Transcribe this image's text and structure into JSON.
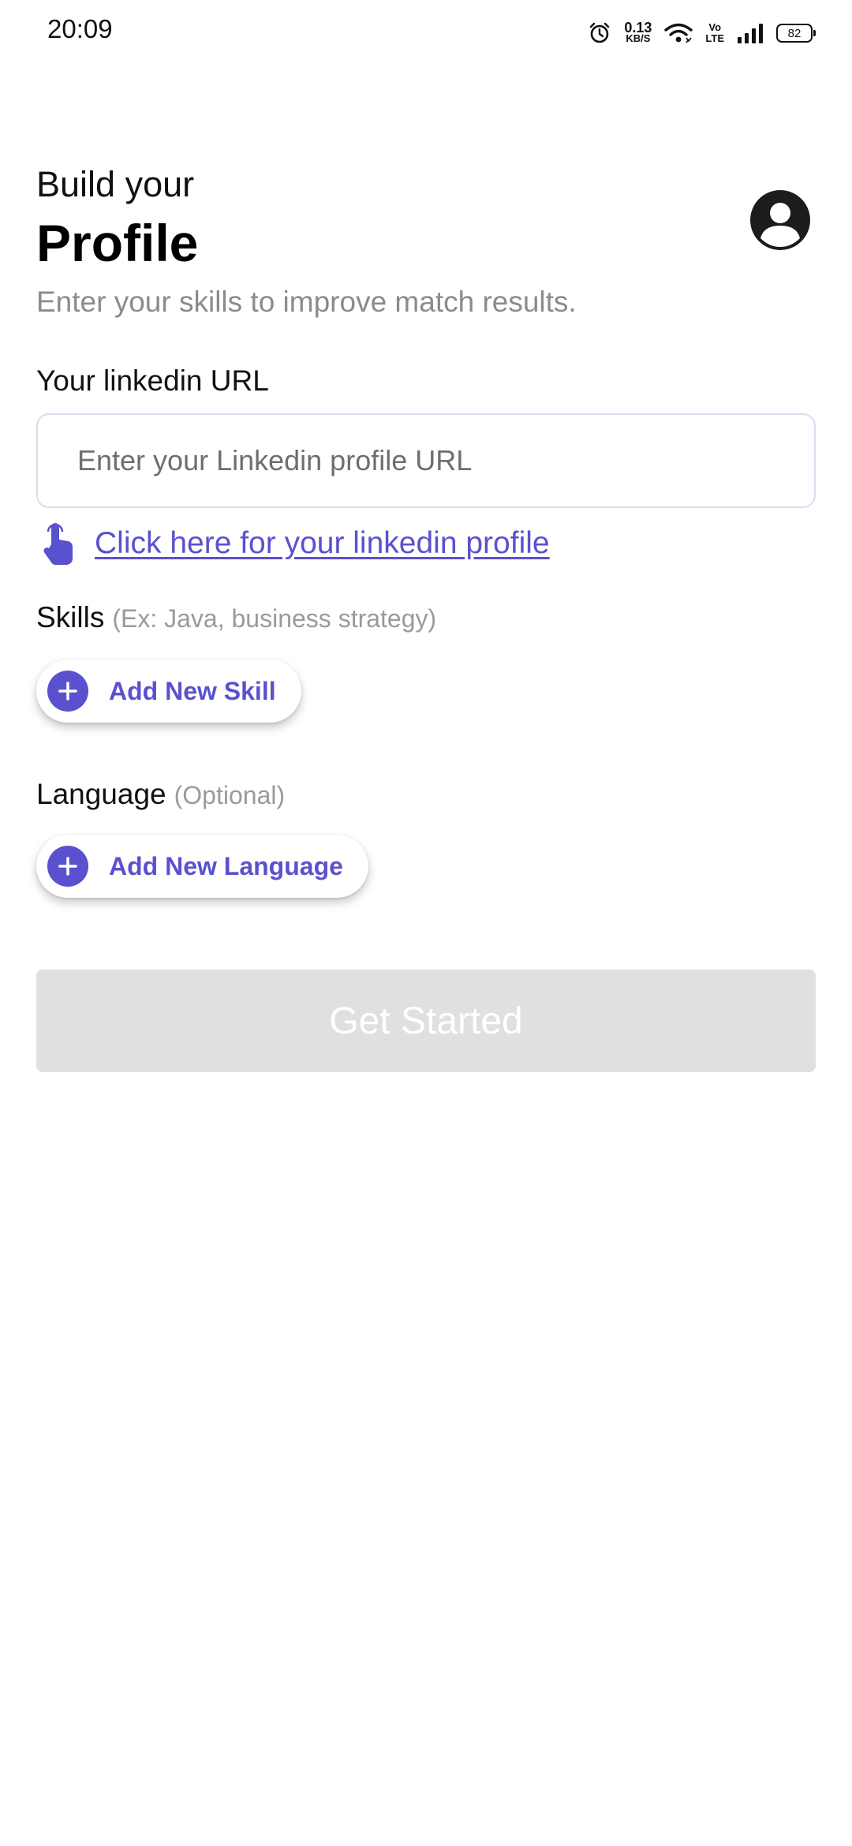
{
  "status_bar": {
    "time": "20:09",
    "net_speed_value": "0.13",
    "net_speed_unit": "KB/S",
    "volte_top": "Vo",
    "volte_bottom": "LTE",
    "battery": "82",
    "icons": [
      "alarm-icon",
      "wifi-icon",
      "signal-icon",
      "battery-icon"
    ]
  },
  "header": {
    "title_pre": "Build your",
    "title_main": "Profile",
    "subtitle": "Enter your skills to improve match results.",
    "avatar_icon": "user-avatar-icon"
  },
  "linkedin": {
    "label": "Your linkedin URL",
    "placeholder": "Enter your Linkedin profile URL",
    "value": "",
    "link_text": "Click here for your linkedin profile",
    "link_icon": "tap-pointer-icon"
  },
  "skills": {
    "label": "Skills",
    "hint": "(Ex: Java, business strategy)",
    "add_button": "Add New Skill"
  },
  "language": {
    "label": "Language",
    "hint": "(Optional)",
    "add_button": "Add New Language"
  },
  "cta": {
    "label": "Get Started",
    "enabled": false
  },
  "colors": {
    "accent": "#5a51cf",
    "muted_text": "#8b8b8b",
    "disabled_button": "#e0e0e0",
    "input_border": "#dcdcef"
  }
}
